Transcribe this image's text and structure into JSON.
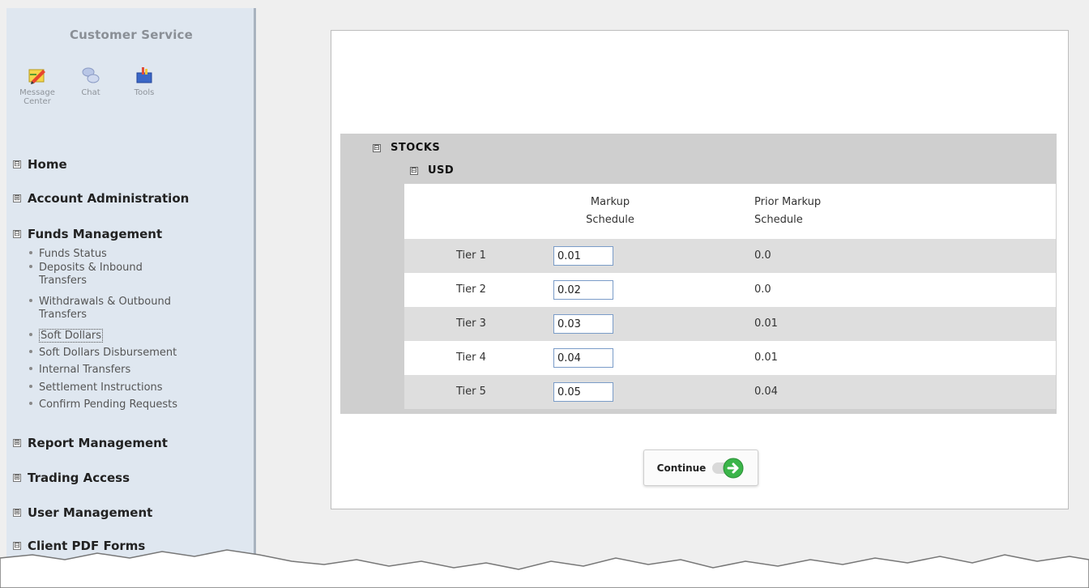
{
  "sidebar": {
    "title": "Customer Service",
    "tools": [
      {
        "label_l1": "Message",
        "label_l2": "Center",
        "icon": "pencil-note-icon"
      },
      {
        "label_l1": "Chat",
        "label_l2": "",
        "icon": "chat-bubbles-icon"
      },
      {
        "label_l1": "Tools",
        "label_l2": "",
        "icon": "toolbox-icon"
      }
    ],
    "nav": {
      "home": "Home",
      "account_admin": "Account Administration",
      "funds_mgmt": "Funds Management",
      "funds_items": [
        {
          "l1": "Funds Status",
          "l2": ""
        },
        {
          "l1": "Deposits & Inbound",
          "l2": "Transfers"
        },
        {
          "l1": "Withdrawals & Outbound",
          "l2": "Transfers"
        },
        {
          "l1": "Soft Dollars",
          "l2": ""
        },
        {
          "l1": "Soft Dollars Disbursement",
          "l2": ""
        },
        {
          "l1": "Internal Transfers",
          "l2": ""
        },
        {
          "l1": "Settlement Instructions",
          "l2": ""
        },
        {
          "l1": "Confirm Pending Requests",
          "l2": ""
        }
      ],
      "report_mgmt": "Report Management",
      "trading_access": "Trading Access",
      "user_mgmt": "User Management",
      "client_pdf": "Client PDF Forms",
      "toggle_expanded": "⊟",
      "toggle_collapsed": "⊞"
    }
  },
  "main": {
    "group": "STOCKS",
    "subgroup": "USD",
    "col_markup_l1": "Markup",
    "col_markup_l2": "Schedule",
    "col_prior_l1": "Prior Markup",
    "col_prior_l2": "Schedule",
    "rows": [
      {
        "tier": "Tier 1",
        "markup": "0.01",
        "prior": "0.0"
      },
      {
        "tier": "Tier 2",
        "markup": "0.02",
        "prior": "0.0"
      },
      {
        "tier": "Tier 3",
        "markup": "0.03",
        "prior": "0.01"
      },
      {
        "tier": "Tier 4",
        "markup": "0.04",
        "prior": "0.01"
      },
      {
        "tier": "Tier 5",
        "markup": "0.05",
        "prior": "0.04"
      }
    ],
    "continue_label": "Continue"
  },
  "colors": {
    "sidebar_bg": "#dfe7f0",
    "panel_gray": "#cfcfcf",
    "row_gray": "#dedede",
    "continue_green": "#3bb54a"
  }
}
